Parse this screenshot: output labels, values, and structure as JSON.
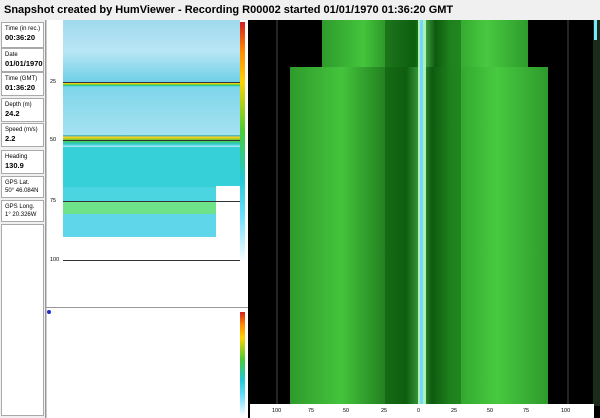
{
  "window": {
    "title": "Snapshot created by HumViewer - Recording R00002 started 01/01/1970 01:36:20 GMT"
  },
  "info": [
    {
      "label": "Time (in rec.)",
      "value": "00:36:20"
    },
    {
      "label": "Date",
      "value": "01/01/1970"
    },
    {
      "label": "Time (GMT)",
      "value": "01:36:20"
    },
    {
      "label": "Depth (m)",
      "value": "24.2"
    },
    {
      "label": "Speed (m/s)",
      "value": "2.2"
    },
    {
      "label": "Heading",
      "value": "130.9"
    },
    {
      "label": "GPS Lat.",
      "value": "50° 46.084N"
    },
    {
      "label": "GPS Long.",
      "value": "1° 20.326W"
    }
  ],
  "downscan": {
    "depth_labels": [
      "25",
      "50",
      "75",
      "100"
    ]
  },
  "sidescan": {
    "range_labels": [
      "100",
      "75",
      "50",
      "25",
      "0",
      "25",
      "50",
      "75",
      "100"
    ]
  }
}
